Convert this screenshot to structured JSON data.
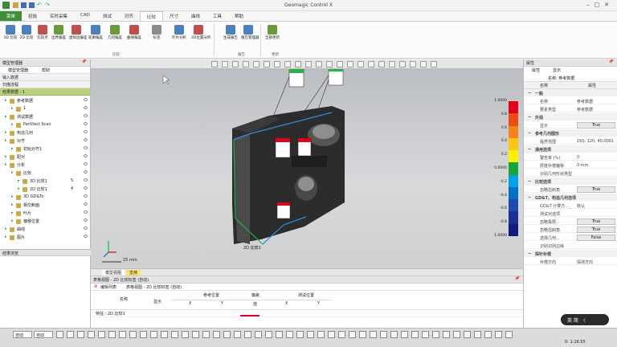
{
  "app": {
    "title": "Geomagic Control X"
  },
  "tabs": [
    "菜单",
    "初始",
    "实时采集",
    "CAD",
    "测试",
    "对齐",
    "比较",
    "尺寸",
    "曲线",
    "工具",
    "帮助"
  ],
  "active_tab": "比较",
  "ribbon": {
    "buttons": [
      "3D 比较",
      "2D 比较",
      "比较点",
      "边界偏差",
      "虚拟边偏差",
      "轮廓偏差",
      "几何偏差",
      "曲线偏差",
      "标签",
      "叶片分析",
      "2D位置分析",
      "生成报告",
      "报告管理器",
      "全部更新"
    ],
    "groups": [
      "比较",
      "报告",
      "更新"
    ]
  },
  "left_panel": {
    "title": "模型管理器",
    "tabs": [
      "模型管理器",
      "帮助"
    ],
    "sections": [
      "输入数据",
      "扫描流程",
      "结果数据 - 1"
    ],
    "tree": [
      {
        "label": "参考数据",
        "indent": 1
      },
      {
        "label": "1",
        "indent": 2
      },
      {
        "label": "测试数据",
        "indent": 1
      },
      {
        "label": "Partifact Scan",
        "indent": 2
      },
      {
        "label": "构造几何",
        "indent": 1
      },
      {
        "label": "对齐",
        "indent": 1
      },
      {
        "label": "初始对齐1",
        "indent": 2
      },
      {
        "label": "配对",
        "indent": 1
      },
      {
        "label": "分析",
        "indent": 1
      },
      {
        "label": "比较",
        "indent": 2
      },
      {
        "label": "3D 比较1",
        "indent": 3,
        "count": "5"
      },
      {
        "label": "2D 比较1",
        "indent": 3,
        "count": "4"
      },
      {
        "label": "3D GD&Ts",
        "indent": 2
      },
      {
        "label": "相交断面",
        "indent": 2
      },
      {
        "label": "叶片",
        "indent": 2
      },
      {
        "label": "偏移位置",
        "indent": 2
      },
      {
        "label": "曲线",
        "indent": 1
      },
      {
        "label": "图片",
        "indent": 1
      }
    ],
    "footer_title": "结果浏览"
  },
  "viewport": {
    "scale_label": "25 mm",
    "view_label": "2D 比较1",
    "legend_values": [
      "1.0000",
      "0.8",
      "0.6",
      "0.4",
      "0.2",
      "0.0000",
      "-0.2",
      "-0.4",
      "-0.6",
      "-0.8",
      "-1.0000"
    ],
    "colors": [
      "#e2001a",
      "#ef4a12",
      "#f7831a",
      "#ffc414",
      "#fff200",
      "#19a43a",
      "#00a2e8",
      "#0072c6",
      "#2048b0",
      "#1a2f93",
      "#151a7d"
    ]
  },
  "bottom_panel": {
    "title": "表格视图 - 2D 比较标签 (自动)",
    "tabs": [
      "模型视图",
      "支持"
    ],
    "subtabs": [
      "编辑列表",
      "表格视图 - 2D 比较标签 (自动)"
    ],
    "headers": [
      "名称",
      "显示",
      "参考位置",
      "偏差",
      "测试位置"
    ],
    "subheaders": [
      "X",
      "Y",
      "值",
      "X",
      "Y"
    ],
    "row": "特征 : 2D 比较1"
  },
  "right_panel": {
    "title": "属性",
    "tabs": [
      "属性",
      "显示"
    ],
    "name_label": "名称: 参考数据",
    "col_name": "名称",
    "col_value": "属性",
    "rows": [
      {
        "type": "sec",
        "k": "一般"
      },
      {
        "type": "row",
        "k": "名称",
        "v": "参考数据"
      },
      {
        "type": "row",
        "k": "要素类型",
        "v": "参考数据"
      },
      {
        "type": "sec",
        "k": "外观"
      },
      {
        "type": "btn",
        "k": "显示",
        "v": "True"
      },
      {
        "type": "sec",
        "k": "参考几何图形"
      },
      {
        "type": "row",
        "k": "临界范围",
        "v": "160, 120, 40.0001"
      },
      {
        "type": "sec",
        "k": "通用选项"
      },
      {
        "type": "row",
        "k": "警告率 (%)",
        "v": "0"
      },
      {
        "type": "row",
        "k": "厚度补偿偏移",
        "v": "0 mm"
      },
      {
        "type": "row",
        "k": "识别几何形状类型",
        "v": ""
      },
      {
        "type": "sec",
        "k": "比较选项"
      },
      {
        "type": "btn",
        "k": "忽略坦斜角",
        "v": "True"
      },
      {
        "type": "sec",
        "k": "GD&T，构造几何选项"
      },
      {
        "type": "row",
        "k": "GD&T 计算方...",
        "v": "默认"
      },
      {
        "type": "row",
        "k": "测试对选项",
        "v": ""
      },
      {
        "type": "btn",
        "k": "忽略极限...",
        "v": "True"
      },
      {
        "type": "btn",
        "k": "忽略坦斜角",
        "v": "True"
      },
      {
        "type": "btn",
        "k": "选择几何...",
        "v": "False"
      },
      {
        "type": "row",
        "k": "识别识别边缘",
        "v": ""
      },
      {
        "type": "sec",
        "k": "探针补偿"
      },
      {
        "type": "row",
        "k": "补偿方向",
        "v": "探测方向"
      }
    ]
  },
  "statusbar": {
    "select1": "自动",
    "select2": "自动",
    "time": "0: 1:16.55",
    "ime": "英 简"
  }
}
